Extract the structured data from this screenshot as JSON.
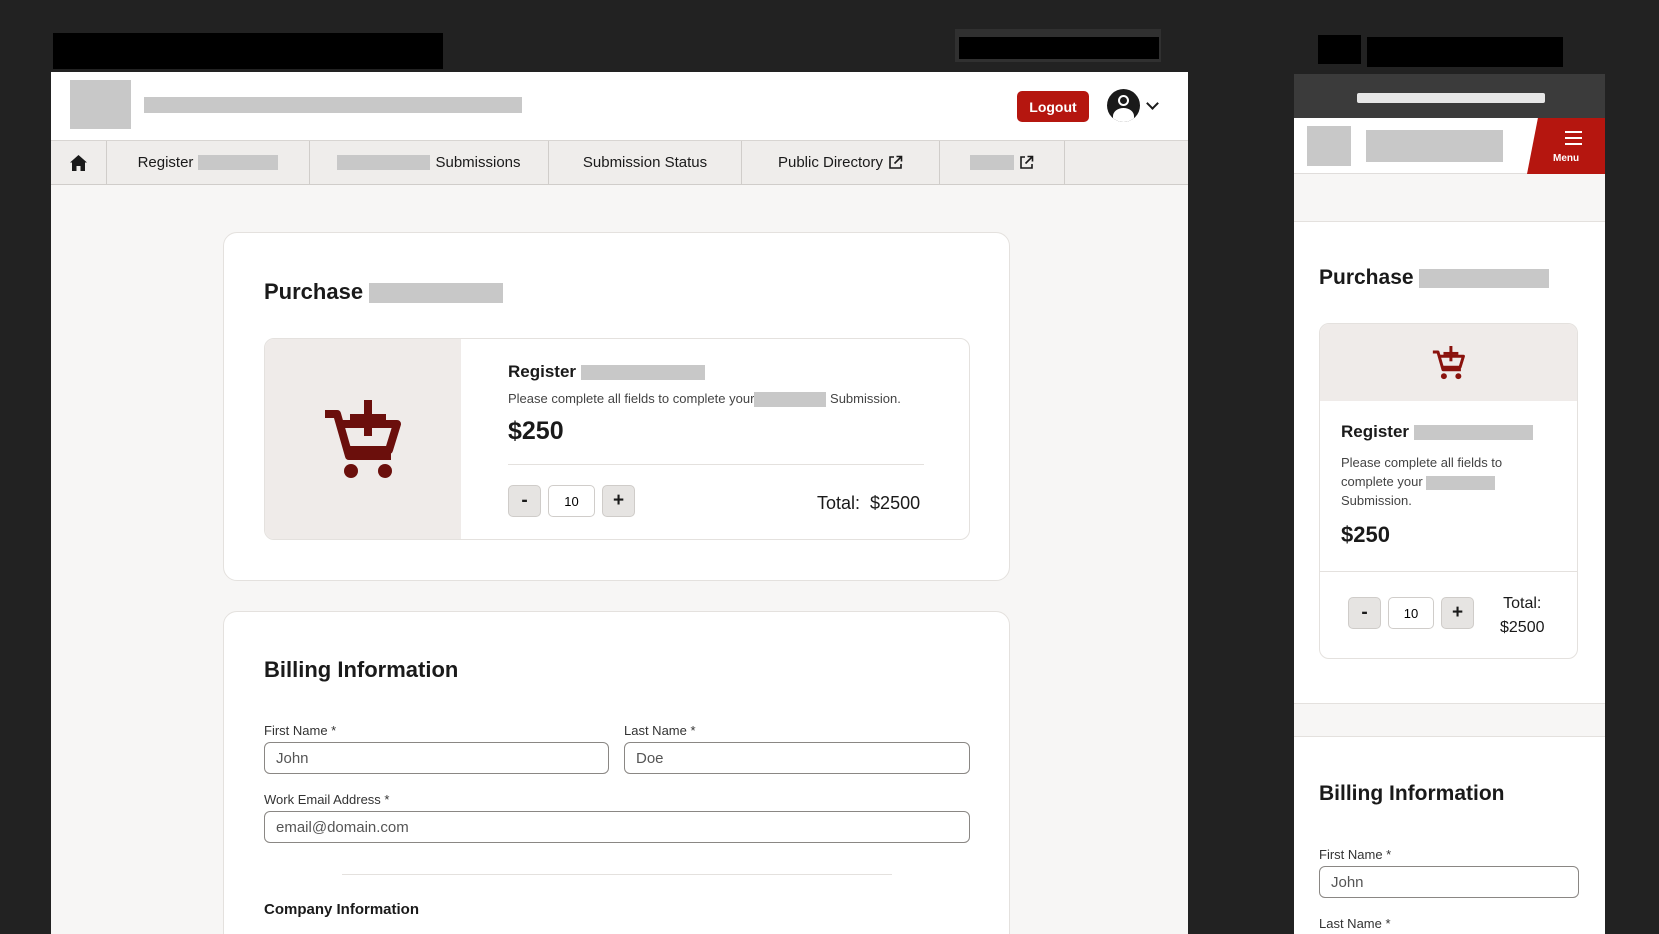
{
  "desktop": {
    "header": {
      "logout_label": "Logout"
    },
    "nav": {
      "items": [
        {
          "label": "Register"
        },
        {
          "label": "Submissions"
        },
        {
          "label": "Submission Status"
        },
        {
          "label": "Public Directory"
        }
      ]
    },
    "purchase": {
      "title": "Purchase",
      "product_name": "Register",
      "description_pre": "Please complete all fields to complete your",
      "description_post": "Submission.",
      "price": "$250",
      "quantity": "10",
      "decrement_label": "-",
      "increment_label": "+",
      "total_label": "Total:",
      "total_value": "$2500"
    },
    "billing": {
      "title": "Billing Information",
      "first_name_label": "First Name *",
      "first_name_placeholder": "John",
      "last_name_label": "Last Name *",
      "last_name_placeholder": "Doe",
      "email_label": "Work Email Address *",
      "email_placeholder": "email@domain.com",
      "company_heading": "Company Information"
    }
  },
  "mobile": {
    "menu_label": "Menu",
    "purchase": {
      "title": "Purchase",
      "product_name": "Register",
      "description_line1": "Please complete all fields to",
      "description_line2": "complete your",
      "description_line3": "Submission.",
      "price": "$250",
      "quantity": "10",
      "decrement_label": "-",
      "increment_label": "+",
      "total_label": "Total:",
      "total_value": "$2500"
    },
    "billing": {
      "title": "Billing Information",
      "first_name_label": "First Name *",
      "first_name_placeholder": "John",
      "last_name_label": "Last Name *"
    }
  },
  "colors": {
    "accent": "#b5160f",
    "cart_icon_dark": "#6b0f0c",
    "cart_icon_mobile": "#8a120d"
  },
  "icons": [
    "home-icon",
    "external-link-icon",
    "user-avatar-icon",
    "chevron-down-icon",
    "cart-add-icon",
    "hamburger-menu-icon"
  ]
}
